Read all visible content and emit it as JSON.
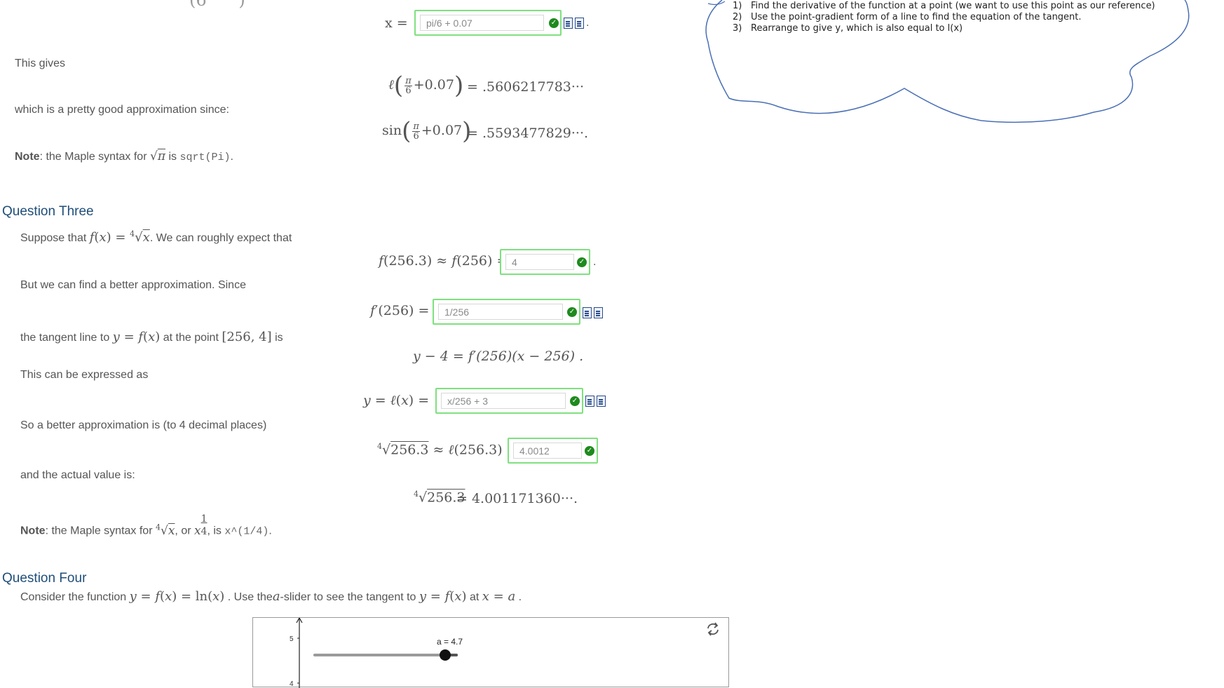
{
  "top": {
    "x_label": "x =",
    "x_answer": "pi/6 + 0.07",
    "gives_text": "This gives",
    "ell_value": "= .5606217783···",
    "approx_text": "which is a pretty good approximation since:",
    "sin_value": "= .5593477829···.",
    "note_label": "Note",
    "note_text": ": the Maple syntax for",
    "note_is": "is",
    "note_code": "sqrt(Pi)",
    "note_end": "."
  },
  "q3": {
    "heading": "Question Three",
    "suppose_text": "Suppose that",
    "suppose_after": ". We can roughly expect that",
    "f_approx_answer": "4",
    "better_text": "But we can find a better approximation. Since",
    "fprime_answer": "1/256",
    "tangent_text": "the tangent line to",
    "tangent_mid": "at the point",
    "tangent_point": "[256, 4]",
    "tangent_is": "is",
    "tangent_eq": "y − 4 = f′(256)(x − 256) .",
    "expressed_text": "This can be expressed as",
    "ell_answer": "x/256 + 3",
    "better_approx_text": "So a better approximation is (to 4 decimal places)",
    "root_answer": "4.0012",
    "actual_text": "and the actual value is:",
    "actual_value": "= 4.001171360···.",
    "note_label": "Note",
    "note_text": ": the Maple syntax for",
    "note_or": ", or",
    "note_is": ", is",
    "note_code": "x^(1/4)",
    "note_end": "."
  },
  "q4": {
    "heading": "Question Four",
    "consider_text": "Consider the function",
    "use_text": ". Use the",
    "slider_text": "-slider to see the tangent to",
    "at_text": "at",
    "end": ".",
    "slider_label": "a = 4.7",
    "slider_value": 4.7,
    "y_tick_top": "5",
    "y_tick_bottom": "4"
  },
  "cloud": {
    "steps": [
      {
        "num": "1)",
        "text": "Find the derivative of the function at a point (we want to use this point as our reference)"
      },
      {
        "num": "2)",
        "text": "Use the point-gradient form of a line to find the equation of the tangent."
      },
      {
        "num": "3)",
        "text": "Rearrange to give y, which is also equal to l(x)"
      }
    ]
  },
  "icons": {
    "check": "check-circle-icon",
    "doc": "document-icon",
    "refresh": "refresh-icon"
  },
  "colors": {
    "answer_border": "#7fe07f",
    "check": "#1e8a1e",
    "heading": "#1f4e79",
    "cloud_stroke": "#4a6fb5"
  }
}
